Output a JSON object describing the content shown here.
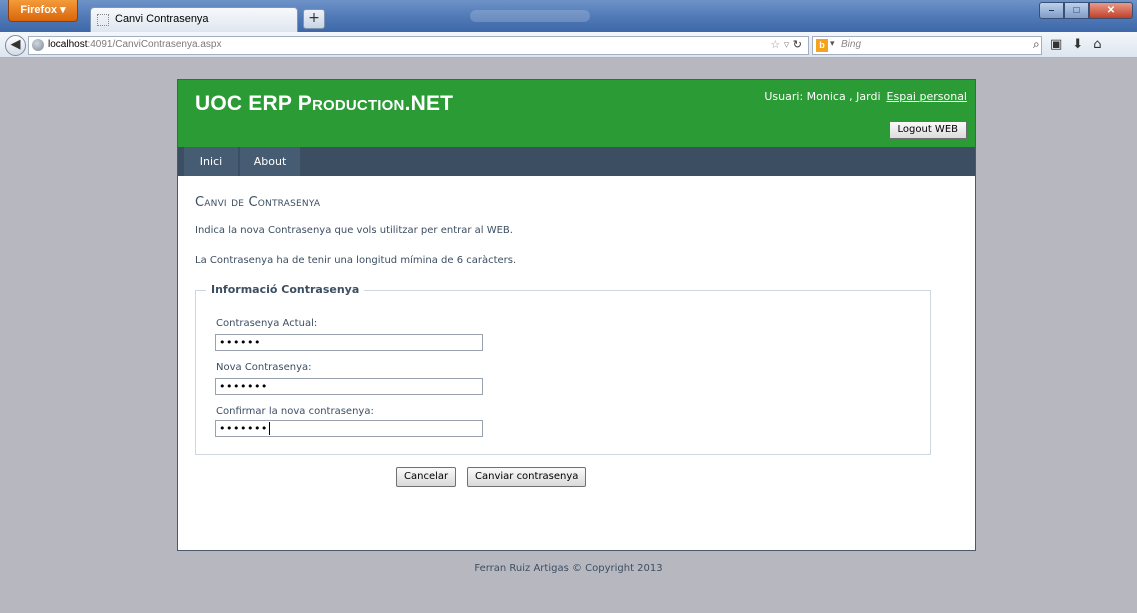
{
  "browser": {
    "menu_button": "Firefox",
    "tab_title": "Canvi Contrasenya",
    "new_tab": "+",
    "url_host": "localhost",
    "url_rest": ":4091/CanviContrasenya.aspx",
    "search_placeholder": "Bing"
  },
  "header": {
    "site_title": "UOC ERP Production.NET",
    "user_label": "Usuari: Monica , Jardi",
    "personal_link": "Espai personal",
    "logout_label": "Logout WEB"
  },
  "menu": {
    "items": [
      {
        "label": "Inici"
      },
      {
        "label": "About"
      }
    ]
  },
  "main": {
    "title": "Canvi de Contrasenya",
    "instruction": "Indica la nova Contrasenya que vols utilitzar per entrar al WEB.",
    "length_note": "La Contrasenya ha de tenir una longitud mímina de 6 caràcters.",
    "fieldset_legend": "Informació Contrasenya",
    "fields": [
      {
        "label": "Contrasenya Actual:",
        "value": "••••••"
      },
      {
        "label": "Nova Contrasenya:",
        "value": "•••••••"
      },
      {
        "label": "Confirmar la nova contrasenya:",
        "value": "•••••••"
      }
    ],
    "cancel_label": "Cancelar",
    "change_label": "Canviar contrasenya"
  },
  "footer": {
    "copyright": "Ferran Ruiz Artigas © Copyright 2013"
  }
}
